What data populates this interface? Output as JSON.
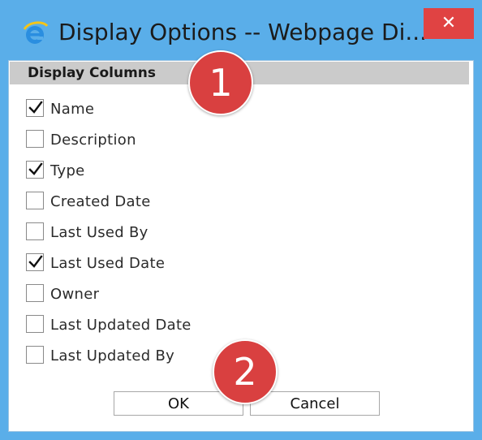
{
  "window": {
    "title": "Display Options -- Webpage Di...",
    "close_label": "✕"
  },
  "section": {
    "header": "Display Columns"
  },
  "columns": [
    {
      "label": "Name",
      "checked": true
    },
    {
      "label": "Description",
      "checked": false
    },
    {
      "label": "Type",
      "checked": true
    },
    {
      "label": "Created Date",
      "checked": false
    },
    {
      "label": "Last Used By",
      "checked": false
    },
    {
      "label": "Last Used Date",
      "checked": true
    },
    {
      "label": "Owner",
      "checked": false
    },
    {
      "label": "Last Updated Date",
      "checked": false
    },
    {
      "label": "Last Updated By",
      "checked": false
    }
  ],
  "buttons": {
    "ok_label": "OK",
    "cancel_label": "Cancel"
  },
  "markers": {
    "m1": "1",
    "m2": "2"
  },
  "colors": {
    "titlebar": "#5aaee9",
    "close_button": "#e04343",
    "section_header": "#cbcbcb",
    "marker": "#d94040"
  },
  "icons": {
    "app": "internet-explorer-icon",
    "close": "close-icon",
    "check": "checkmark-icon"
  }
}
